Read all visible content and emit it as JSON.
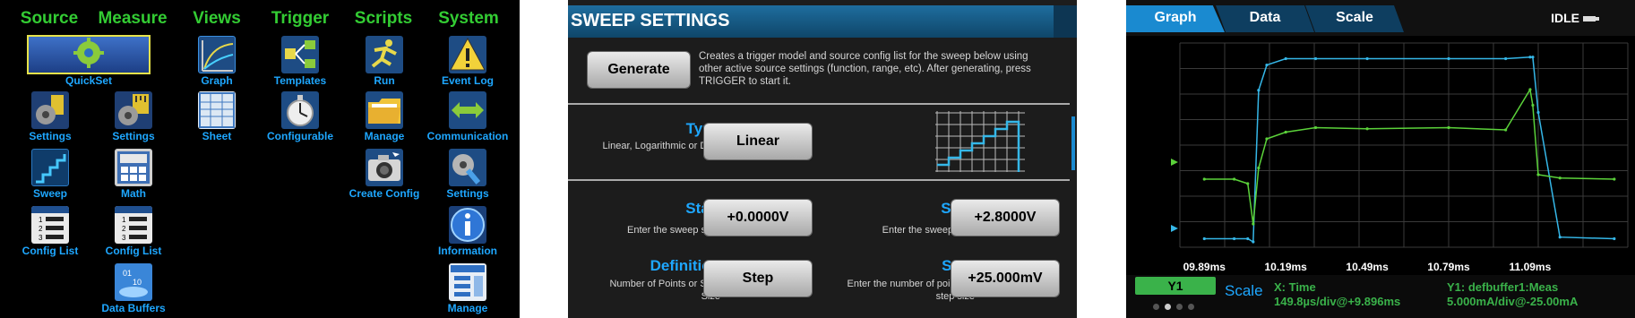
{
  "menu": {
    "headers": [
      "Source",
      "Measure",
      "Views",
      "Trigger",
      "Scripts",
      "System"
    ],
    "items": {
      "quickset": "QuickSet",
      "source_settings": "Settings",
      "measure_settings": "Settings",
      "sweep": "Sweep",
      "math": "Math",
      "source_config_list": "Config List",
      "measure_config_list": "Config List",
      "data_buffers": "Data Buffers",
      "graph": "Graph",
      "sheet": "Sheet",
      "templates": "Templates",
      "configurable": "Configurable",
      "run": "Run",
      "manage_scripts": "Manage",
      "create_config": "Create Config",
      "event_log": "Event Log",
      "communication": "Communication",
      "system_settings": "Settings",
      "information": "Information",
      "manage_system": "Manage"
    }
  },
  "sweep": {
    "title": "SWEEP SETTINGS",
    "generate_label": "Generate",
    "generate_desc": "Creates a trigger model and source config list for the sweep below using other active source settings (function, range, etc). After generating, press TRIGGER to start it.",
    "type": {
      "label": "Type",
      "hint": "Linear, Logarithmic or Dual",
      "value": "Linear"
    },
    "start": {
      "label": "Start",
      "hint": "Enter the sweep start",
      "value": "+0.0000V"
    },
    "stop": {
      "label": "Stop",
      "hint": "Enter the sweep stop",
      "value": "+2.8000V"
    },
    "definition": {
      "label": "Definition",
      "hint": "Number of Points or Step Size",
      "value": "Step"
    },
    "step": {
      "label": "Step",
      "hint": "Enter the number of points or step size",
      "value": "+25.000mV"
    }
  },
  "graph": {
    "tabs": [
      "Graph",
      "Data",
      "Scale"
    ],
    "status": "IDLE",
    "x_ticks": [
      "09.89ms",
      "10.19ms",
      "10.49ms",
      "10.79ms",
      "11.09ms"
    ],
    "y1_label": "Y1",
    "scale_label": "Scale",
    "x_info_line1": "X: Time",
    "x_info_line2": "149.8µs/div@+9.896ms",
    "y_info_line1": "Y1: defbuffer1:Meas",
    "y_info_line2": "5.000mA/div@-25.00mA",
    "colors": {
      "trace_current": "#35b7e8",
      "trace_voltage": "#5bd23a",
      "accent": "#1ea7ff"
    }
  },
  "chart_data": {
    "type": "line",
    "x": [
      9.89,
      10.0,
      10.05,
      10.07,
      10.09,
      10.12,
      10.19,
      10.3,
      10.49,
      10.79,
      11.0,
      11.09,
      11.1,
      11.12,
      11.2,
      11.4
    ],
    "series": [
      {
        "values": [
          -35.0,
          -35.0,
          -35.0,
          -36.0,
          12.0,
          20.0,
          22.0,
          22.0,
          22.0,
          22.0,
          22.0,
          22.5,
          22.5,
          5.0,
          -34.5,
          -35.0
        ]
      },
      {
        "values": [
          -20.0,
          -20.0,
          -22.0,
          -40.0,
          -15.0,
          -2.0,
          1.0,
          3.0,
          2.5,
          3.0,
          2.0,
          20.0,
          13.0,
          -18.0,
          -19.5,
          -20.0
        ]
      }
    ],
    "xlim": [
      9.8,
      11.45
    ],
    "grid": true
  }
}
